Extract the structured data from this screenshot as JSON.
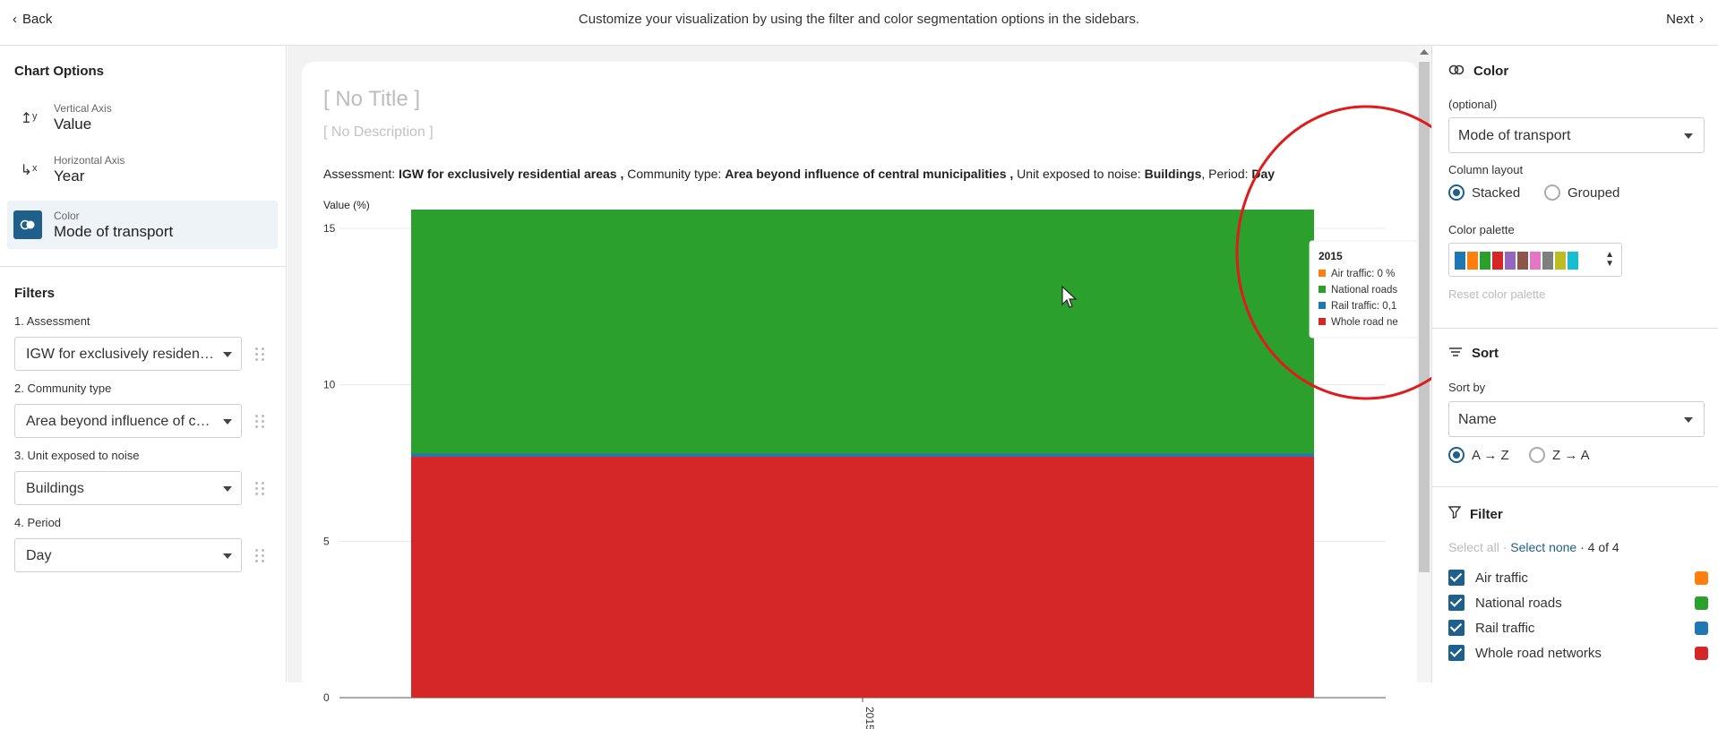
{
  "topbar": {
    "back_label": "Back",
    "message": "Customize your visualization by using the filter and color segmentation options in the sidebars.",
    "next_label": "Next"
  },
  "left": {
    "chart_options_title": "Chart Options",
    "options": [
      {
        "label": "Vertical Axis",
        "value": "Value",
        "icon": "vertical-axis-icon"
      },
      {
        "label": "Horizontal Axis",
        "value": "Year",
        "icon": "horizontal-axis-icon"
      },
      {
        "label": "Color",
        "value": "Mode of transport",
        "icon": "color-segment-icon"
      }
    ],
    "filters_title": "Filters",
    "filters": [
      {
        "label": "1. Assessment",
        "value": "IGW for exclusively residential areas"
      },
      {
        "label": "2. Community type",
        "value": "Area beyond influence of central municipalities"
      },
      {
        "label": "3. Unit exposed to noise",
        "value": "Buildings"
      },
      {
        "label": "4. Period",
        "value": "Day"
      }
    ]
  },
  "card": {
    "title": "[ No Title ]",
    "description": "[ No Description ]",
    "meta": {
      "k1": "Assessment: ",
      "v1": "IGW for exclusively residential areas ,",
      "k2": " Community type: ",
      "v2": "Area beyond influence of central municipalities ,",
      "k3": " Unit exposed to noise: ",
      "v3": "Buildings",
      "k4": ", Period: ",
      "v4": "Day"
    },
    "ylabel": "Value (%)"
  },
  "chart_data": {
    "type": "bar",
    "stacked": true,
    "categories": [
      "2015"
    ],
    "ylim": [
      0,
      15.6
    ],
    "yticks": [
      0,
      5,
      10,
      15
    ],
    "series": [
      {
        "name": "Whole road networks",
        "values": [
          7.7
        ],
        "color": "#d62728"
      },
      {
        "name": "Rail traffic",
        "values": [
          0.1
        ],
        "color": "#1f77b4"
      },
      {
        "name": "National roads",
        "values": [
          7.8
        ],
        "color": "#2ca02c"
      },
      {
        "name": "Air traffic",
        "values": [
          0
        ],
        "color": "#ff7f0e"
      }
    ],
    "tooltip": {
      "title": "2015",
      "lines": [
        "Air traffic: 0 %",
        "National roads",
        "Rail traffic: 0,1",
        "Whole road ne"
      ]
    }
  },
  "right": {
    "color_title": "Color",
    "optional": "(optional)",
    "color_select": "Mode of transport",
    "column_layout_label": "Column layout",
    "layout_options": [
      "Stacked",
      "Grouped"
    ],
    "palette_label": "Color palette",
    "palette": [
      "#1f77b4",
      "#ff7f0e",
      "#2ca02c",
      "#d62728",
      "#9467bd",
      "#8c564b",
      "#e377c2",
      "#7f7f7f",
      "#bcbd22",
      "#17becf"
    ],
    "reset_palette": "Reset color palette",
    "sort_title": "Sort",
    "sort_by_label": "Sort by",
    "sort_select": "Name",
    "sort_options": [
      "A → Z",
      "Z → A"
    ],
    "filter_title": "Filter",
    "select_all": "Select all",
    "select_none": "Select none",
    "count": "4 of 4",
    "items": [
      {
        "label": "Air traffic",
        "color": "#ff7f0e"
      },
      {
        "label": "National roads",
        "color": "#2ca02c"
      },
      {
        "label": "Rail traffic",
        "color": "#1f77b4"
      },
      {
        "label": "Whole road networks",
        "color": "#d62728"
      }
    ]
  }
}
